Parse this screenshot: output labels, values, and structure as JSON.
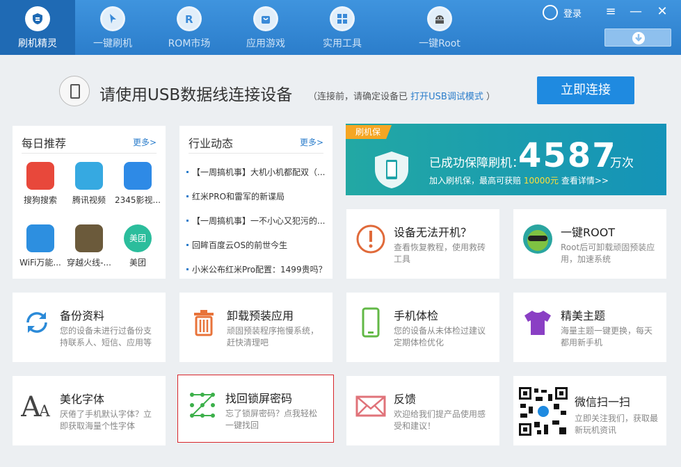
{
  "nav": {
    "items": [
      {
        "label": "刷机精灵",
        "icon": "shield-logo-icon"
      },
      {
        "label": "一键刷机",
        "icon": "cursor-icon"
      },
      {
        "label": "ROM市场",
        "icon": "rom-icon"
      },
      {
        "label": "应用游戏",
        "icon": "bag-icon"
      },
      {
        "label": "实用工具",
        "icon": "grid-icon"
      },
      {
        "label": "一键Root",
        "icon": "android-icon"
      }
    ],
    "login_label": "登录"
  },
  "connect": {
    "title": "请使用USB数据线连接设备",
    "note_prefix": "（连接前，请确定设备已 ",
    "note_link": "打开USB调试模式",
    "note_suffix": " ）",
    "button": "立即连接"
  },
  "daily": {
    "title": "每日推荐",
    "more": "更多>",
    "apps": [
      {
        "name": "搜狗搜索",
        "color": "#e8483b"
      },
      {
        "name": "腾讯视频",
        "color": "#36a9e1"
      },
      {
        "name": "2345影视...",
        "color": "#2e8ae6"
      },
      {
        "name": "WiFi万能...",
        "color": "#2d8fe0"
      },
      {
        "name": "穿越火线-...",
        "color": "#6b5a3b"
      },
      {
        "name": "美团",
        "color": "#2bbd9c",
        "text": "美团"
      }
    ]
  },
  "industry": {
    "title": "行业动态",
    "more": "更多>",
    "items": [
      "【一周搞机事】大机小机都配双（...",
      "红米PRO和雷军的新谍局",
      "【一周搞机事】一不小心又犯污的...",
      "回眸百度云OS的前世今生",
      "小米公布红米Pro配置：1499贵吗？"
    ]
  },
  "banner": {
    "tag": "刷机保",
    "text1": "已成功保障刷机：",
    "count": "4587",
    "unit": "万次",
    "text2a": "加入刷机保，最高可获赔 ",
    "text2b": "10000元",
    "text2c": "  查看详情>>"
  },
  "tiles": [
    {
      "title": "设备无法开机？",
      "desc": "查看恢复教程，使用救砖工具",
      "icon": "warning-icon"
    },
    {
      "title": "一键ROOT",
      "desc": "Root后可卸载顽固预装应用，加速系统",
      "icon": "root-mascot-icon"
    },
    {
      "title": "备份资料",
      "desc": "您的设备未进行过备份支持联系人、短信、应用等",
      "icon": "sync-icon"
    },
    {
      "title": "卸载预装应用",
      "desc": "顽固预装程序拖慢系统，赶快清理吧",
      "icon": "trash-icon"
    },
    {
      "title": "手机体检",
      "desc": "您的设备从未体检过建议定期体检优化",
      "icon": "phone-check-icon"
    },
    {
      "title": "精美主题",
      "desc": "海量主题一键更换，每天都用新手机",
      "icon": "tshirt-icon"
    },
    {
      "title": "美化字体",
      "desc": "厌倦了手机默认字体？立即获取海量个性字体",
      "icon": "font-icon"
    },
    {
      "title": "找回锁屏密码",
      "desc": "忘了锁屏密码？点我轻松一键找回",
      "icon": "pattern-lock-icon"
    },
    {
      "title": "反馈",
      "desc": "欢迎给我们提产品使用感受和建议！",
      "icon": "envelope-icon"
    },
    {
      "title": "微信扫一扫",
      "desc": "立即关注我们，获取最新玩机资讯",
      "icon": "qr-code-icon"
    }
  ]
}
